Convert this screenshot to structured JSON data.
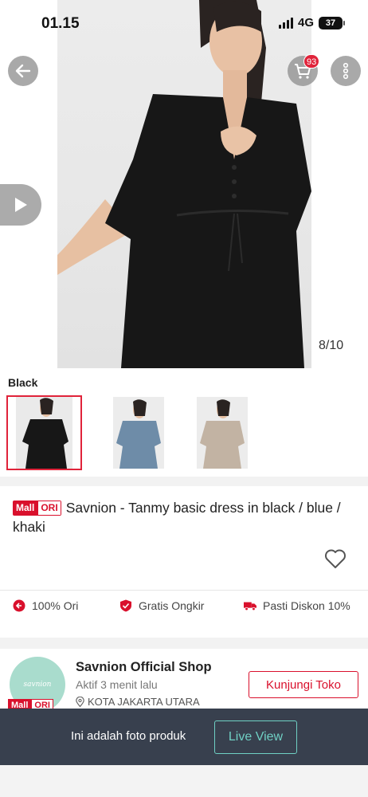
{
  "status_bar": {
    "time": "01.15",
    "network": "4G",
    "battery": "37"
  },
  "header": {
    "cart_count": "93"
  },
  "gallery": {
    "counter": "8/10"
  },
  "variant": {
    "label": "Black",
    "options": [
      "Black",
      "Blue",
      "Khaki"
    ],
    "colors": [
      "#1b1b1b",
      "#6e8ca8",
      "#c2b3a3"
    ]
  },
  "product": {
    "badge_mall": "Mall",
    "badge_ori": "ORI",
    "title": "Savnion - Tanmy basic dress in black / blue / khaki"
  },
  "features": [
    {
      "label": "100% Ori",
      "icon": "ori-return-icon"
    },
    {
      "label": "Gratis Ongkir",
      "icon": "shield-check-icon"
    },
    {
      "label": "Pasti Diskon 10%",
      "icon": "truck-icon"
    }
  ],
  "shop": {
    "name": "Savnion Official Shop",
    "active": "Aktif 3 menit lalu",
    "location": "KOTA JAKARTA UTARA",
    "avatar_text": "savnion",
    "badge_mall": "Mall",
    "badge_ori": "ORI",
    "visit_label": "Kunjungi Toko"
  },
  "banner": {
    "text": "Ini adalah foto produk",
    "button": "Live View"
  },
  "colors": {
    "accent": "#d9102c",
    "banner_bg": "#38404e",
    "live_accent": "#6fd0c4"
  }
}
